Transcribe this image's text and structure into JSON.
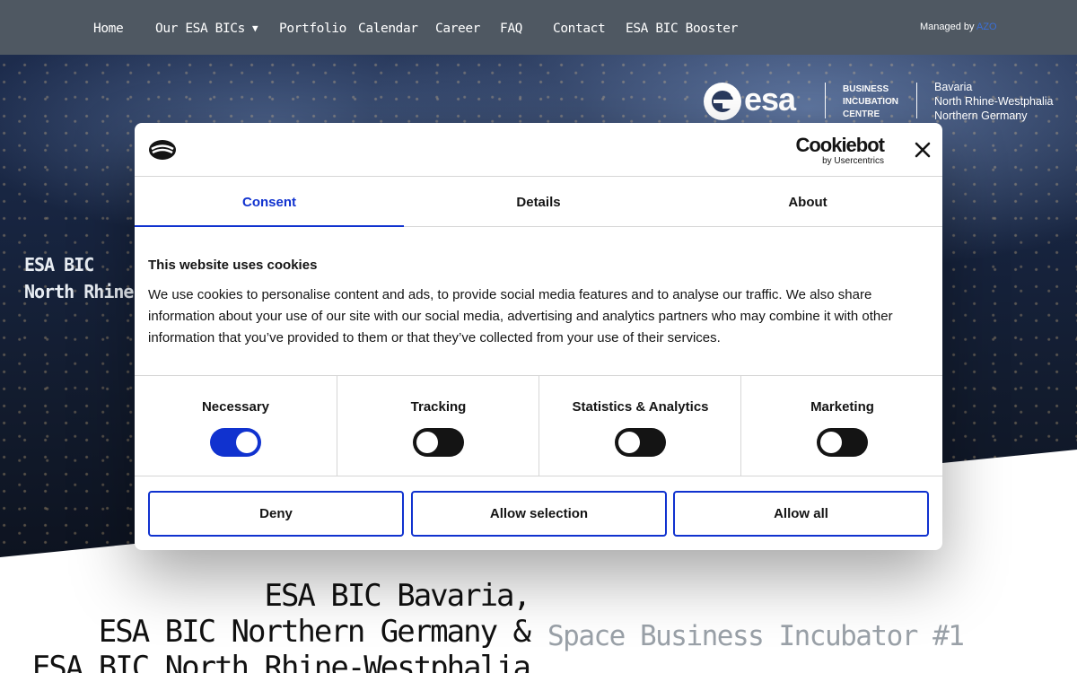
{
  "nav": {
    "items": [
      {
        "label": "Home"
      },
      {
        "label": "Our ESA BICs",
        "has_dropdown": true
      },
      {
        "label": "Portfolio"
      },
      {
        "label": "Calendar"
      },
      {
        "label": "Career"
      },
      {
        "label": "FAQ"
      },
      {
        "label": "Contact"
      },
      {
        "label": "ESA BIC Booster"
      }
    ],
    "managed_by_prefix": "Managed by",
    "managed_by_link": "AZO"
  },
  "esa_logo": {
    "wordmark": "esa",
    "bic_lines": [
      "BUSINESS",
      "INCUBATION",
      "CENTRE"
    ],
    "regions": [
      "Bavaria",
      "North Rhine-Westphalia",
      "Northern Germany"
    ]
  },
  "hero": {
    "line1": "ESA BIC",
    "line2": "North Rhine"
  },
  "content": {
    "headline": [
      "ESA BIC Bavaria,",
      "ESA BIC Northern Germany &",
      "ESA BIC North Rhine-Westphalia"
    ],
    "tagline": "Space Business Incubator #1"
  },
  "cookie_dialog": {
    "brand": "Cookiebot",
    "brand_sub": "by Usercentrics",
    "tabs": [
      "Consent",
      "Details",
      "About"
    ],
    "active_tab": "Consent",
    "title": "This website uses cookies",
    "body": "We use cookies to personalise content and ads, to provide social media features and to analyse our traffic. We also share information about your use of our site with our social media, advertising and analytics partners who may combine it with other information that you’ve provided to them or that they’ve collected from your use of their services.",
    "categories": [
      {
        "label": "Necessary",
        "enabled": true
      },
      {
        "label": "Tracking",
        "enabled": false
      },
      {
        "label": "Statistics & Analytics",
        "enabled": false
      },
      {
        "label": "Marketing",
        "enabled": false
      }
    ],
    "buttons": {
      "deny": "Deny",
      "allow_selection": "Allow selection",
      "allow_all": "Allow all"
    },
    "accent_color": "#1032cf"
  },
  "colors": {
    "nav_background": "#4f5862",
    "managed_link": "#3b6fd6",
    "tagline": "#9aa1a8"
  },
  "icons": {
    "dropdown": "chevron-down-icon",
    "close": "close-icon",
    "cookiebot_logo": "cookiebot-logo-icon",
    "esa_mark": "esa-logo-icon"
  }
}
